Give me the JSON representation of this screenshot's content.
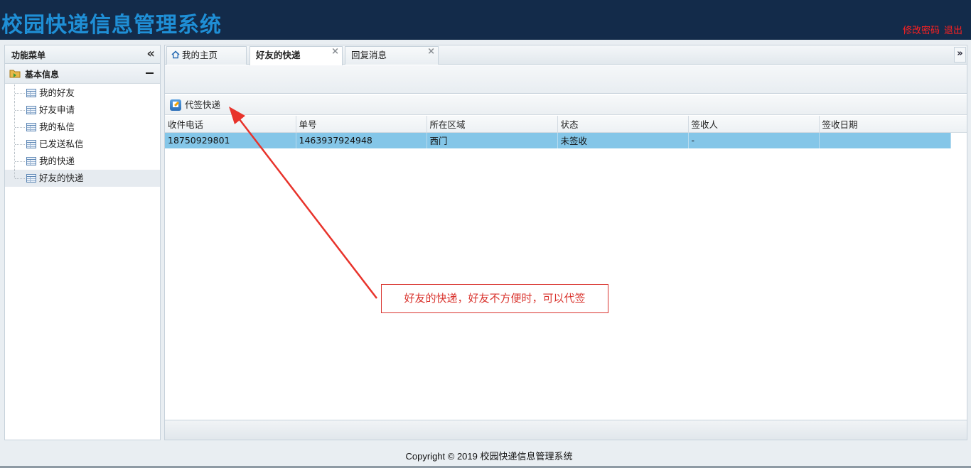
{
  "header": {
    "title": "校园快递信息管理系统",
    "change_password": "修改密码",
    "logout": "退出"
  },
  "sidebar": {
    "title": "功能菜单",
    "group_title": "基本信息",
    "items": [
      {
        "label": "我的好友"
      },
      {
        "label": "好友申请"
      },
      {
        "label": "我的私信"
      },
      {
        "label": "已发送私信"
      },
      {
        "label": "我的快递"
      },
      {
        "label": "好友的快递"
      }
    ],
    "active_index": 5
  },
  "tabs": [
    {
      "label": "我的主页"
    },
    {
      "label": "好友的快递"
    },
    {
      "label": "回复消息"
    }
  ],
  "toolbar": {
    "sign_button": "代签快递"
  },
  "table": {
    "columns": [
      "收件电话",
      "单号",
      "所在区域",
      "状态",
      "签收人",
      "签收日期"
    ],
    "rows": [
      [
        "18750929801",
        "1463937924948",
        "西门",
        "未签收",
        "-",
        ""
      ]
    ]
  },
  "annotation": {
    "text": "好友的快递，好友不方便时，可以代签"
  },
  "footer": {
    "copyright": "Copyright © 2019 校园快递信息管理系统"
  },
  "colors": {
    "header_bg": "#132b4a",
    "title_color": "#1f8fd6",
    "link_color": "#ff2020",
    "selected_row": "#84c6e8",
    "annotation_red": "#d9332d"
  }
}
